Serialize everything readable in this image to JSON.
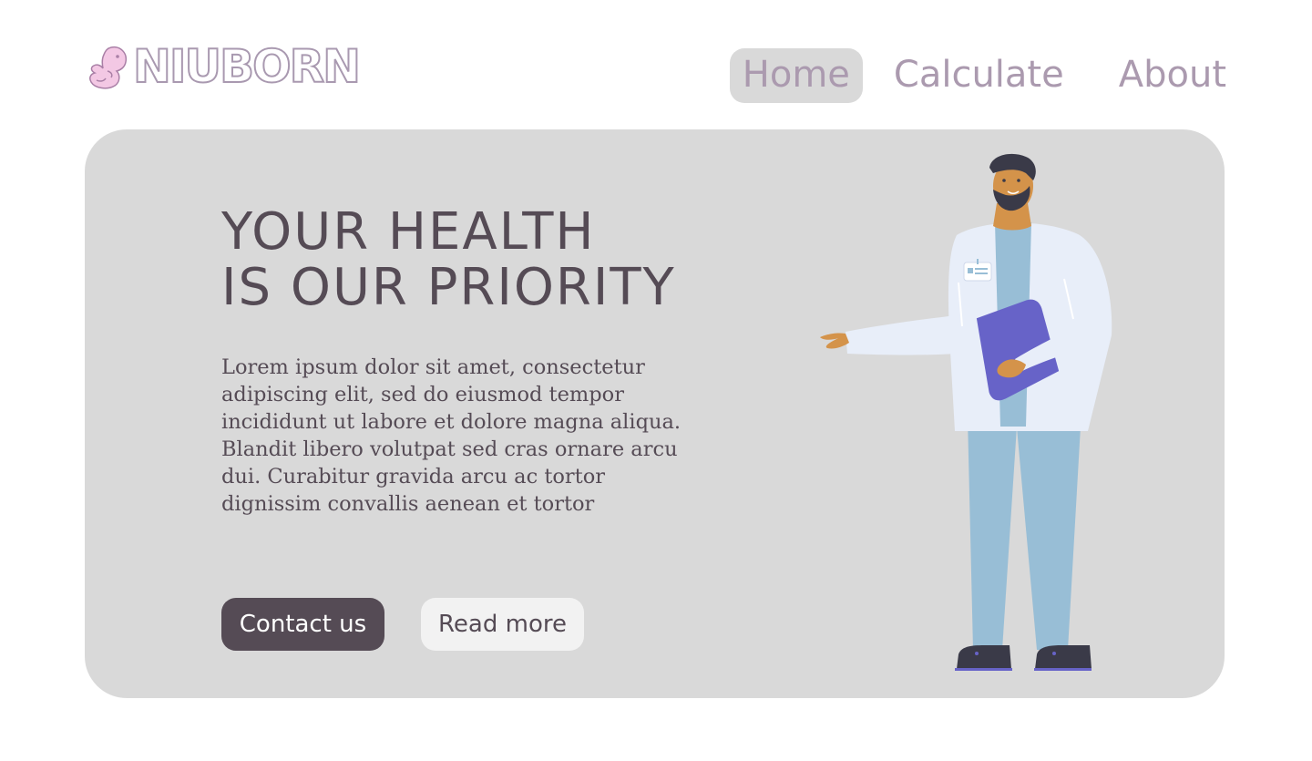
{
  "header": {
    "logo_text": "NIUBORN",
    "logo_icon": "baby-fetus-icon",
    "nav": [
      {
        "label": "Home",
        "active": true
      },
      {
        "label": "Calculate",
        "active": false
      },
      {
        "label": "About",
        "active": false
      }
    ]
  },
  "hero": {
    "title_line1": "YOUR HEALTH",
    "title_line2": "IS OUR PRIORITY",
    "description": "Lorem ipsum dolor sit amet, consectetur adipiscing elit, sed do eiusmod tempor incididunt ut labore et dolore magna aliqua. Blandit libero volutpat sed cras ornare arcu dui. Curabitur gravida arcu ac tortor dignissim convallis aenean et tortor",
    "primary_button": "Contact us",
    "secondary_button": "Read more",
    "illustration": "doctor-illustration"
  },
  "colors": {
    "text_dark": "#554b55",
    "nav_text": "#ab9aaf",
    "panel_bg": "#d9d9d9",
    "logo_pink": "#f3c8e4",
    "clipboard": "#6763c8"
  }
}
